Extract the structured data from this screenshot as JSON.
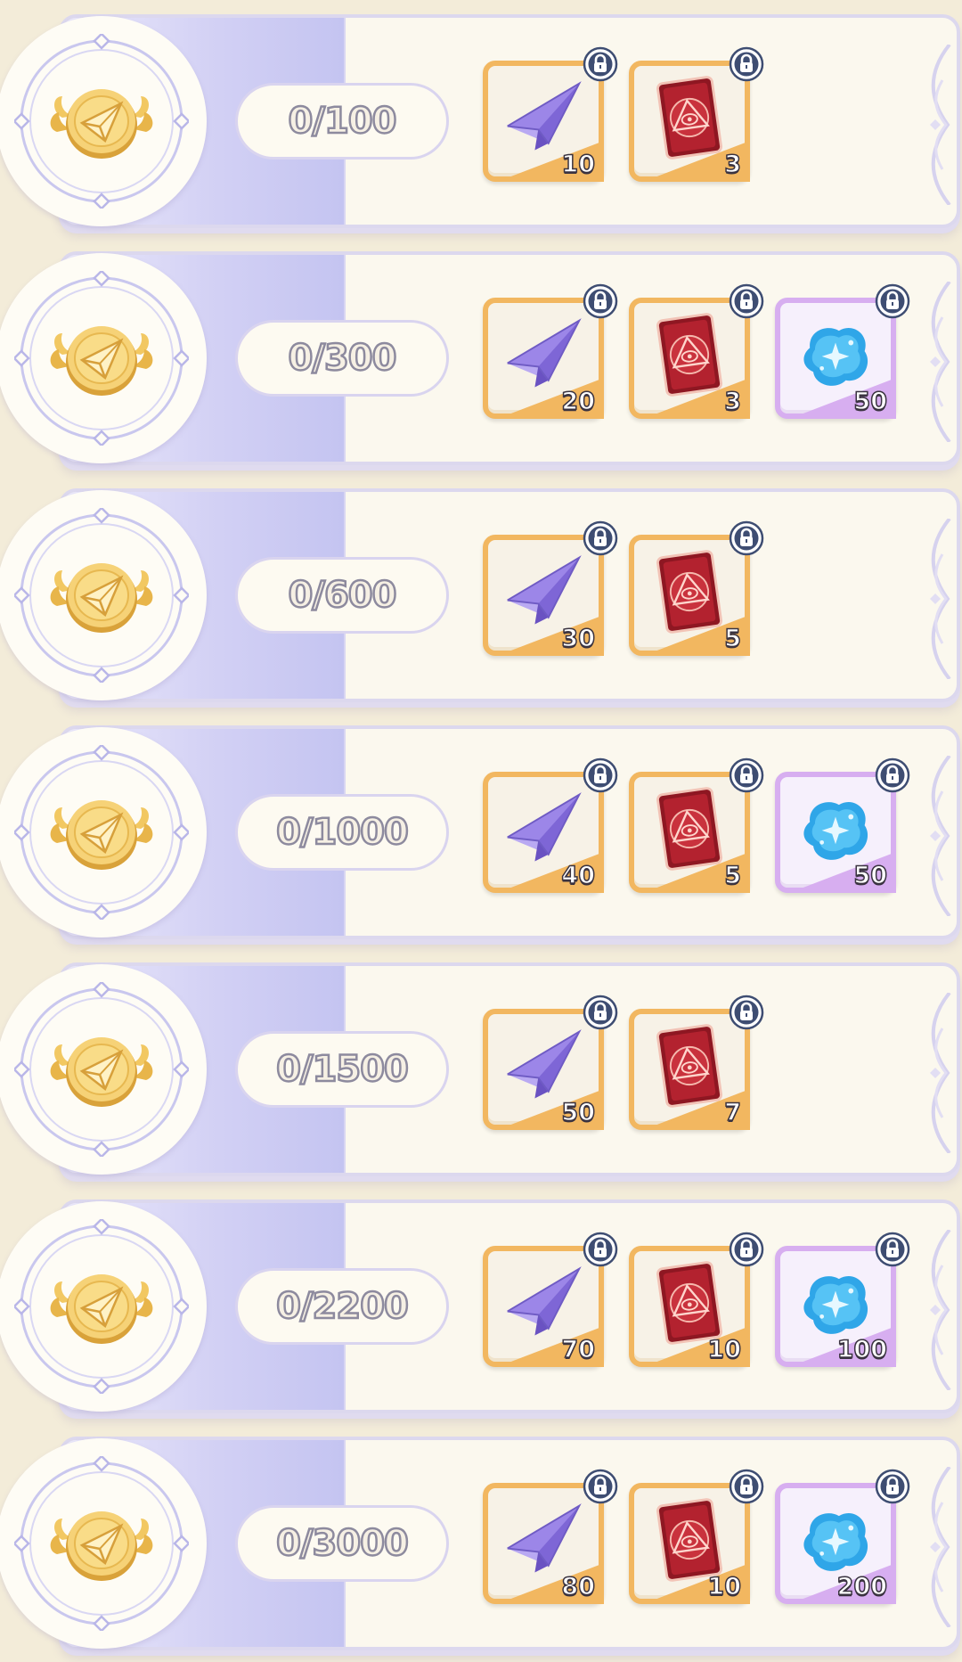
{
  "icons": {
    "medal": "winged-paper-plane-medal-icon",
    "lock": "lock-badge-icon",
    "paper_plane": "paper-plane-icon",
    "red_card": "red-eye-card-icon",
    "blue_gem": "blue-crystal-icon"
  },
  "colors": {
    "background": "#f3ecd9",
    "row_left_gradient": "#c4c4f1",
    "orange_frame": "#f2b760",
    "purple_frame": "#d7aef0",
    "lock_badge": "#3e4d72"
  },
  "rows": [
    {
      "progress": "0/100",
      "rewards": [
        {
          "item": "paper_plane",
          "qty": "10",
          "frame": "orange"
        },
        {
          "item": "red_card",
          "qty": "3",
          "frame": "orange"
        }
      ]
    },
    {
      "progress": "0/300",
      "rewards": [
        {
          "item": "paper_plane",
          "qty": "20",
          "frame": "orange"
        },
        {
          "item": "red_card",
          "qty": "3",
          "frame": "orange"
        },
        {
          "item": "blue_gem",
          "qty": "50",
          "frame": "purple"
        }
      ]
    },
    {
      "progress": "0/600",
      "rewards": [
        {
          "item": "paper_plane",
          "qty": "30",
          "frame": "orange"
        },
        {
          "item": "red_card",
          "qty": "5",
          "frame": "orange"
        }
      ]
    },
    {
      "progress": "0/1000",
      "rewards": [
        {
          "item": "paper_plane",
          "qty": "40",
          "frame": "orange"
        },
        {
          "item": "red_card",
          "qty": "5",
          "frame": "orange"
        },
        {
          "item": "blue_gem",
          "qty": "50",
          "frame": "purple"
        }
      ]
    },
    {
      "progress": "0/1500",
      "rewards": [
        {
          "item": "paper_plane",
          "qty": "50",
          "frame": "orange"
        },
        {
          "item": "red_card",
          "qty": "7",
          "frame": "orange"
        }
      ]
    },
    {
      "progress": "0/2200",
      "rewards": [
        {
          "item": "paper_plane",
          "qty": "70",
          "frame": "orange"
        },
        {
          "item": "red_card",
          "qty": "10",
          "frame": "orange"
        },
        {
          "item": "blue_gem",
          "qty": "100",
          "frame": "purple"
        }
      ]
    },
    {
      "progress": "0/3000",
      "rewards": [
        {
          "item": "paper_plane",
          "qty": "80",
          "frame": "orange"
        },
        {
          "item": "red_card",
          "qty": "10",
          "frame": "orange"
        },
        {
          "item": "blue_gem",
          "qty": "200",
          "frame": "purple"
        }
      ]
    }
  ]
}
